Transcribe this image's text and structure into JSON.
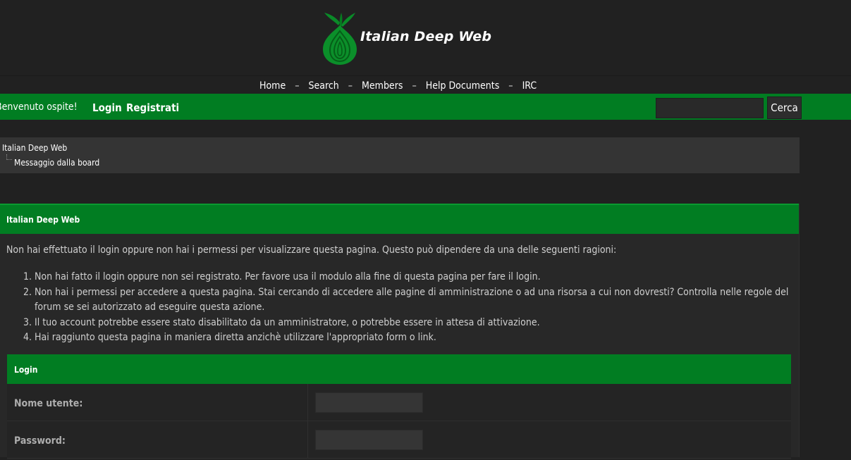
{
  "header": {
    "site_title": "Italian Deep Web",
    "logo_icon": "onion-logo-icon"
  },
  "nav": {
    "items": [
      "Home",
      "Search",
      "Members",
      "Help Documents",
      "IRC"
    ],
    "separator": "–"
  },
  "userbar": {
    "welcome": "Benvenuto ospite!",
    "login": "Login",
    "register": "Registrati",
    "search_value": "",
    "search_button": "Cerca"
  },
  "breadcrumb": {
    "root": "Italian Deep Web",
    "current": "Messaggio dalla board"
  },
  "main": {
    "title": "Italian Deep Web",
    "intro": "Non hai effettuato il login oppure non hai i permessi per visualizzare questa pagina. Questo può dipendere da una delle seguenti ragioni:",
    "reasons": [
      "Non hai fatto il login oppure non sei registrato. Per favore usa il modulo alla fine di questa pagina per fare il login.",
      "Non hai i permessi per accedere a questa pagina. Stai cercando di accedere alle pagine di amministrazione o ad una risorsa a cui non dovresti? Controlla nelle regole del forum se sei autorizzato ad eseguire questa azione.",
      "Il tuo account potrebbe essere stato disabilitato da un amministratore, o potrebbe essere in attesa di attivazione.",
      "Hai raggiunto questa pagina in maniera diretta anzichè utilizzare l'appropriato form o link."
    ]
  },
  "login_form": {
    "title": "Login",
    "username_label": "Nome utente:",
    "username_value": "",
    "password_label": "Password:",
    "password_value": ""
  },
  "colors": {
    "accent_green": "#017d22",
    "background": "#212121",
    "panel": "#282828"
  }
}
